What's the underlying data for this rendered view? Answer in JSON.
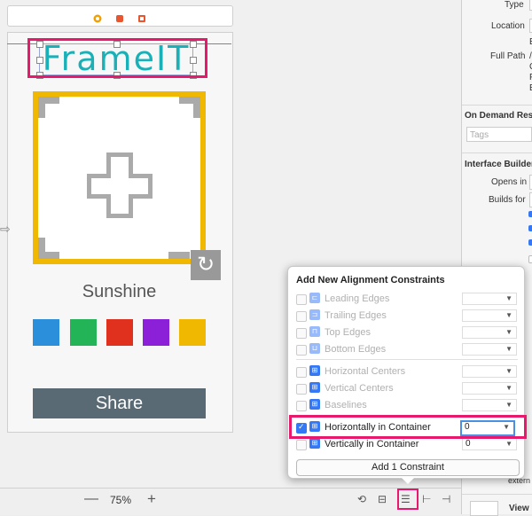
{
  "canvas": {
    "logo_text": "FrameIT",
    "photo_label": "Sunshine",
    "share_label": "Share",
    "swatch_colors": [
      "#2b8fdc",
      "#22b457",
      "#e0301e",
      "#8b20d8",
      "#f0b800"
    ],
    "accent_highlight": "#e8186c",
    "frame_color": "#f0b800"
  },
  "bottom_bar": {
    "zoom_minus": "—",
    "zoom_level": "75%",
    "zoom_plus": "+"
  },
  "inspector": {
    "type_label": "Type",
    "location_label": "Location",
    "full_path_label": "Full Path",
    "path_frag_1": "E",
    "path_frag_2": "/",
    "path_frag_3": "C",
    "path_frag_4": "F",
    "path_frag_5": "E",
    "on_demand_header": "On Demand Reso",
    "tags_placeholder": "Tags",
    "ib_header": "Interface Builder",
    "opens_in_label": "Opens in",
    "builds_for_label": "Builds for",
    "extern_text": "extern",
    "view_label": "View"
  },
  "popover": {
    "title": "Add New Alignment Constraints",
    "rows_group1": [
      {
        "label": "Leading Edges",
        "checked": false,
        "enabled": false,
        "value": ""
      },
      {
        "label": "Trailing Edges",
        "checked": false,
        "enabled": false,
        "value": ""
      },
      {
        "label": "Top Edges",
        "checked": false,
        "enabled": false,
        "value": ""
      },
      {
        "label": "Bottom Edges",
        "checked": false,
        "enabled": false,
        "value": ""
      }
    ],
    "rows_group2": [
      {
        "label": "Horizontal Centers",
        "checked": false,
        "enabled": false,
        "value": ""
      },
      {
        "label": "Vertical Centers",
        "checked": false,
        "enabled": false,
        "value": ""
      },
      {
        "label": "Baselines",
        "checked": false,
        "enabled": false,
        "value": ""
      }
    ],
    "rows_group3": [
      {
        "label": "Horizontally in Container",
        "checked": true,
        "enabled": true,
        "value": "0"
      },
      {
        "label": "Vertically in Container",
        "checked": false,
        "enabled": true,
        "value": "0"
      }
    ],
    "add_button_label": "Add 1 Constraint"
  }
}
